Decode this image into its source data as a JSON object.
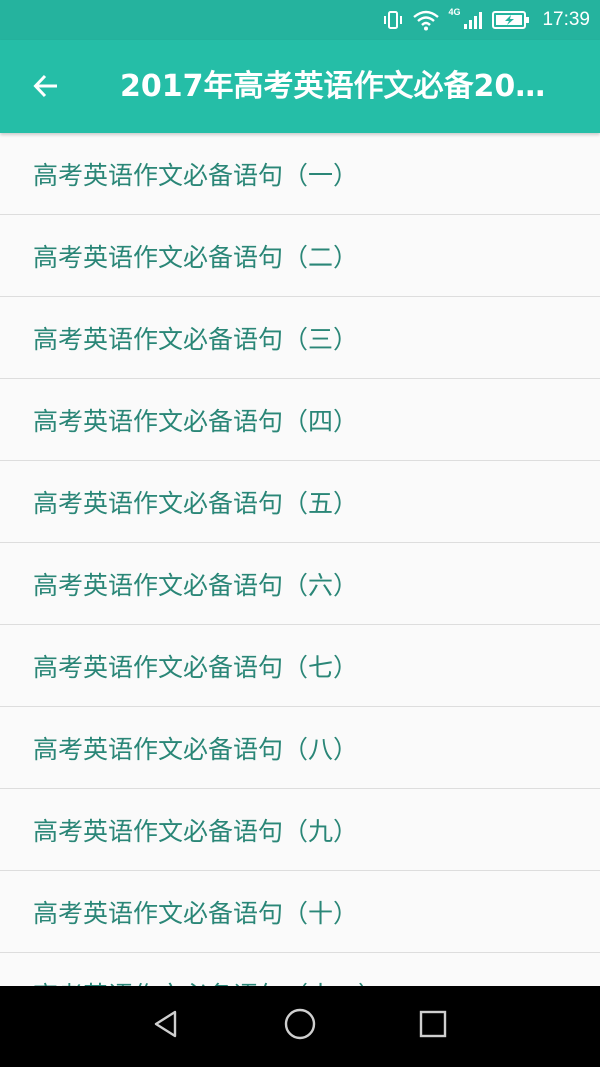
{
  "status_bar": {
    "time": "17:39",
    "network": "4G",
    "icons": [
      "vibrate-icon",
      "wifi-icon",
      "signal-icon",
      "battery-charging-icon"
    ]
  },
  "toolbar": {
    "back_icon": "arrow-left-icon",
    "title": "2017年高考英语作文必备20…"
  },
  "list": {
    "items": [
      {
        "label": "高考英语作文必备语句（一）"
      },
      {
        "label": "高考英语作文必备语句（二）"
      },
      {
        "label": "高考英语作文必备语句（三）"
      },
      {
        "label": "高考英语作文必备语句（四）"
      },
      {
        "label": "高考英语作文必备语句（五）"
      },
      {
        "label": "高考英语作文必备语句（六）"
      },
      {
        "label": "高考英语作文必备语句（七）"
      },
      {
        "label": "高考英语作文必备语句（八）"
      },
      {
        "label": "高考英语作文必备语句（九）"
      },
      {
        "label": "高考英语作文必备语句（十）"
      },
      {
        "label": "高考英语作文必备语句（十一）"
      }
    ]
  },
  "nav_bar": {
    "icons": [
      "back-triangle-icon",
      "home-circle-icon",
      "recents-square-icon"
    ]
  },
  "colors": {
    "status_bar": "#25b39e",
    "toolbar": "#25bea7",
    "list_text": "#2a8677",
    "divider": "#dddddd",
    "background": "#fafafa"
  }
}
